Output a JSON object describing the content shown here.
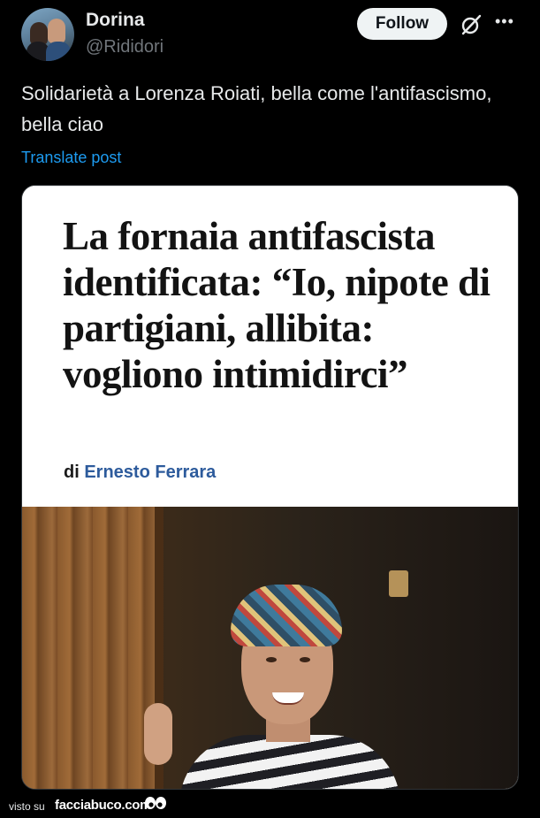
{
  "post": {
    "author": {
      "display_name": "Dorina",
      "handle": "@Rididori"
    },
    "follow_label": "Follow",
    "text": "Solidarietà a Lorenza Roiati, bella come l'antifascismo, bella ciao",
    "translate_label": "Translate post",
    "icons": [
      "grok-icon",
      "more-icon"
    ]
  },
  "media": {
    "headline": "La fornaia antifascista identificata: “Io, nipote di partigiani, allibita: vogliono intimidirci”",
    "byline_prefix": "di",
    "byline_author": "Ernesto Ferrara"
  },
  "footer": {
    "visto_su": "visto su",
    "brand": "facciabuco.com"
  },
  "colors": {
    "background": "#000000",
    "text": "#e7e9ea",
    "secondary": "#71767b",
    "link": "#1d9bf0",
    "author_link": "#2d5b9c"
  }
}
